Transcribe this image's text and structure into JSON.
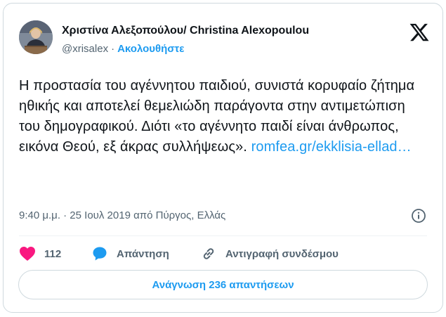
{
  "author": {
    "display_name": "Χριστίνα Αλεξοπούλου/ Christina Alexopoulou",
    "handle": "@xrisalex",
    "separator": "·",
    "follow_label": "Ακολουθήστε",
    "avatar_icon": "person-at-podium-avatar"
  },
  "brand": {
    "logo_icon": "x-logo-icon"
  },
  "tweet": {
    "text": "Η προστασία του αγέννητου παιδιού, συνιστά κορυφαίο ζήτημα ηθικής και αποτελεί θεμελιώδη παράγοντα στην αντιμετώπιση του δημογραφικού. Διότι «το αγέννητο παιδί είναι άνθρωπος, εικόνα Θεού, εξ άκρας συλλήψεως».",
    "link_text": "romfea.gr/ekklisia-ellad…",
    "timestamp": "9:40 μ.μ. · 25 Ιουλ 2019 από Πύργος, Ελλάς"
  },
  "actions": {
    "like_count": "112",
    "reply_label": "Απάντηση",
    "copy_label": "Αντιγραφή συνδέσμου"
  },
  "read_replies_label": "Ανάγνωση 236 απαντήσεων",
  "colors": {
    "accent": "#1d9bf0",
    "like": "#f91880",
    "text_primary": "#0f1419",
    "text_secondary": "#536471",
    "border": "#cfd9de"
  }
}
